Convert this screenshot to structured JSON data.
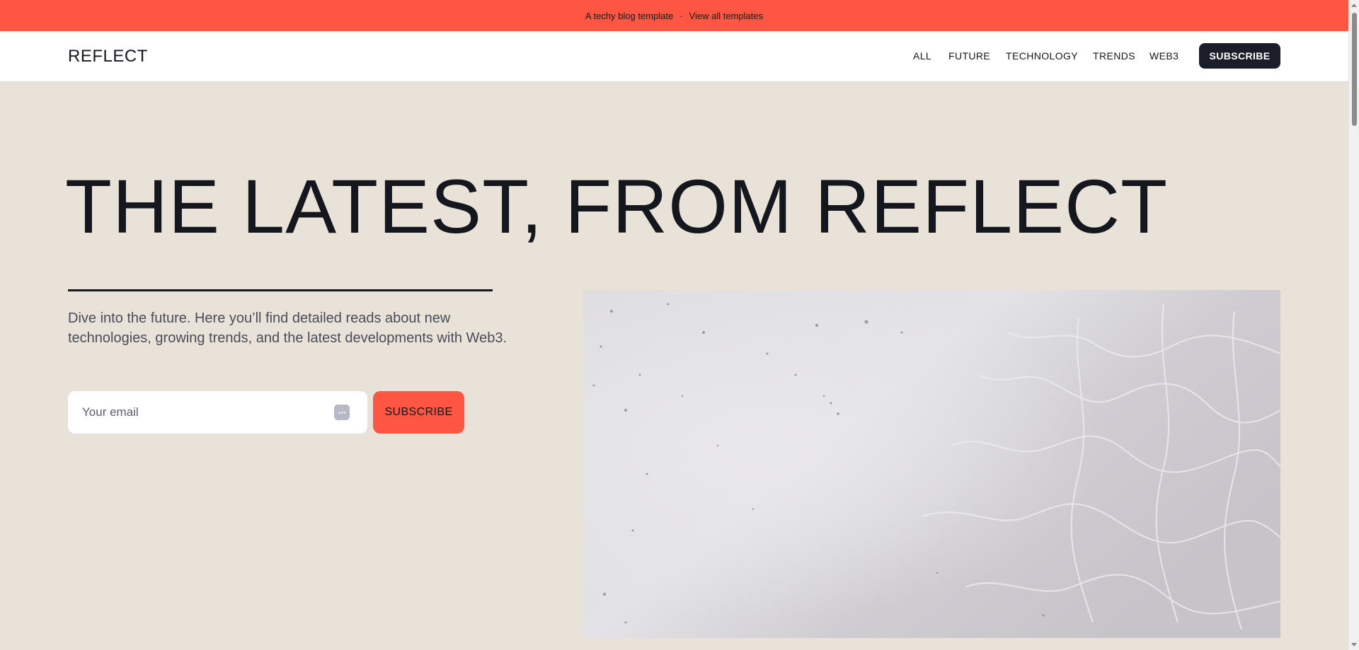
{
  "announcement": {
    "text": "A techy blog template",
    "separator": "·",
    "link": "View all templates"
  },
  "header": {
    "logo": "REFLECT",
    "nav": [
      "ALL",
      "FUTURE",
      "TECHNOLOGY",
      "TRENDS",
      "WEB3"
    ],
    "subscribe_label": "SUBSCRIBE"
  },
  "hero": {
    "title": "THE LATEST, FROM REFLECT",
    "intro": "Dive into the future. Here you’ll find detailed reads about new technologies, growing trends, and the latest developments with Web3.",
    "email_placeholder": "Your email",
    "email_value": "",
    "subscribe_label": "SUBSCRIBE",
    "image_icon": "water-texture-image"
  },
  "colors": {
    "accent": "#ff5543",
    "dark": "#15171f",
    "background": "#e8e2d8"
  }
}
